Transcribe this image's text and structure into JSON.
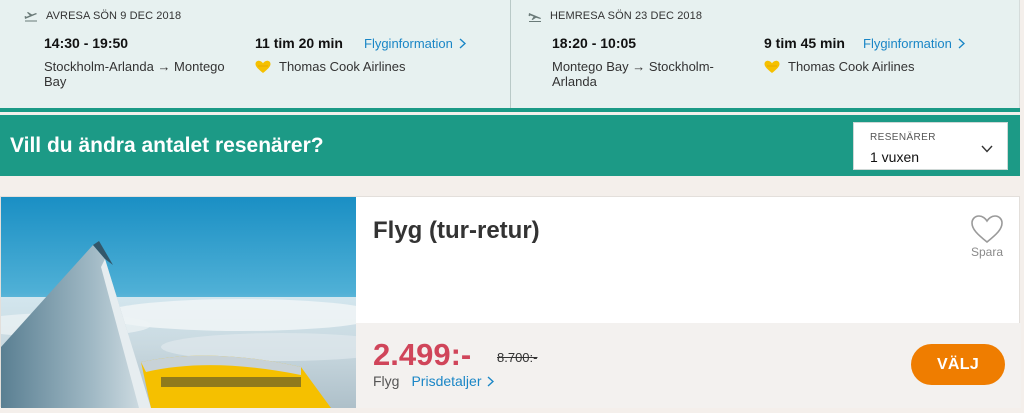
{
  "outbound": {
    "header": "AVRESA SÖN 9 DEC 2018",
    "time": "14:30 - 19:50",
    "route": "Stockholm-Arlanda → Montego Bay",
    "duration": "11 tim 20 min",
    "info_link": "Flyginformation",
    "airline": "Thomas Cook Airlines",
    "icon": "plane-takeoff-icon"
  },
  "return": {
    "header": "HEMRESA SÖN 23 DEC 2018",
    "time": "18:20 - 10:05",
    "route": "Montego Bay → Stockholm-Arlanda",
    "duration": "9 tim 45 min",
    "info_link": "Flyginformation",
    "airline": "Thomas Cook Airlines",
    "icon": "plane-landing-icon"
  },
  "travellers": {
    "title": "Vill du ändra antalet resenärer?",
    "select_label": "RESENÄRER",
    "select_value": "1 vuxen"
  },
  "card": {
    "title": "Flyg (tur-retur)",
    "save_label": "Spara",
    "price": "2.499:-",
    "old_price": "8.700:-",
    "type": "Flyg",
    "details_link": "Prisdetaljer",
    "cta": "VÄLJ"
  },
  "colors": {
    "teal": "#1c9a86",
    "price_red": "#d0455a",
    "cta_orange": "#ef7d00",
    "link_blue": "#1a86c6",
    "airline_logo_yellow": "#f5c000"
  }
}
